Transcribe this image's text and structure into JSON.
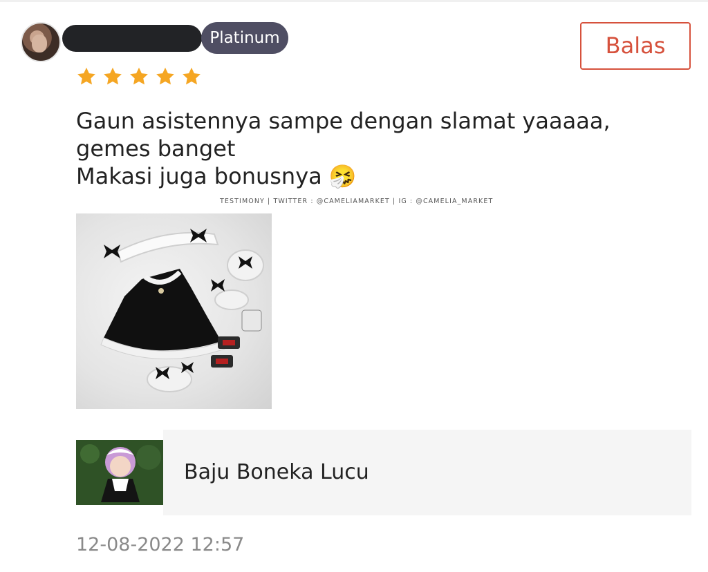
{
  "reviewer": {
    "tier_badge": "Platinum"
  },
  "actions": {
    "reply_label": "Balas"
  },
  "rating": {
    "value": 5,
    "max": 5,
    "star_color": "#f5a623"
  },
  "review": {
    "text": "Gaun asistennya sampe dengan slamat yaaaaa, gemes banget\nMakasi juga bonusnya",
    "emoji": "🤧"
  },
  "watermark": "TESTIMONY | TWITTER : @CAMELIAMARKET | IG : @CAMELIA_MARKET",
  "product": {
    "name": "Baju Boneka Lucu"
  },
  "timestamp": "12-08-2022 12:57",
  "colors": {
    "accent": "#d6513c",
    "badge_bg": "#4f4e63",
    "muted_text": "#8a8a8a"
  }
}
